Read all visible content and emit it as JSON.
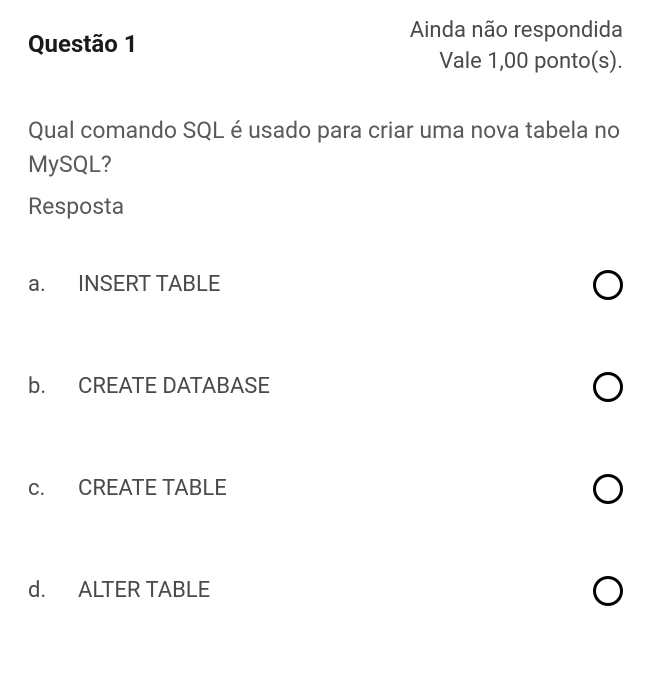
{
  "header": {
    "question_title": "Questão 1",
    "status_line1": "Ainda não respondida",
    "status_line2": "Vale 1,00 ponto(s)."
  },
  "question": {
    "text": "Qual comando SQL é usado para criar uma nova tabela no MySQL?",
    "answer_label": "Resposta"
  },
  "options": [
    {
      "letter": "a.",
      "text": "INSERT TABLE"
    },
    {
      "letter": "b.",
      "text": "CREATE DATABASE"
    },
    {
      "letter": "c.",
      "text": "CREATE TABLE"
    },
    {
      "letter": "d.",
      "text": "ALTER TABLE"
    }
  ]
}
